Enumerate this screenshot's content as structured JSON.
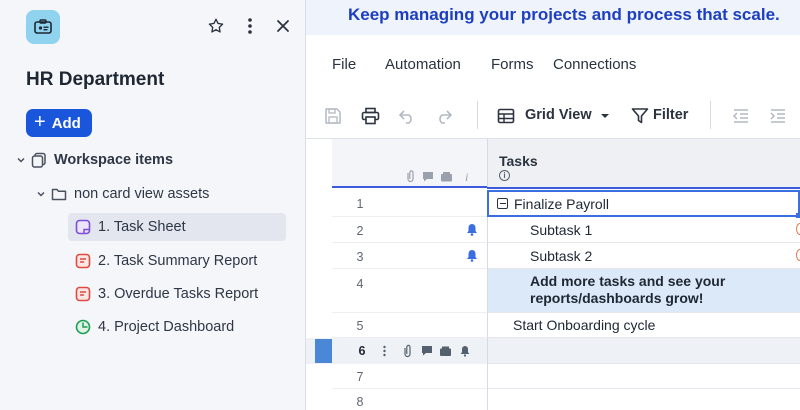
{
  "banner": {
    "text": "Keep managing your projects and process that scale."
  },
  "panel": {
    "title": "HR Department",
    "add_label": "Add",
    "tree": [
      {
        "label": "Workspace items",
        "level": 0,
        "icon": "workspace-icon",
        "bold": true
      },
      {
        "label": "non card view assets",
        "level": 1,
        "icon": "folder-icon",
        "bold": false
      },
      {
        "label": "1. Task Sheet",
        "level": 2,
        "icon": "sheet-icon",
        "color": "#7b4fd6",
        "selected": true
      },
      {
        "label": "2. Task Summary Report",
        "level": 2,
        "icon": "report-icon",
        "color": "#e04a3f"
      },
      {
        "label": "3. Overdue Tasks Report",
        "level": 2,
        "icon": "report-icon",
        "color": "#e04a3f"
      },
      {
        "label": "4. Project Dashboard",
        "level": 2,
        "icon": "dashboard-icon",
        "color": "#1f9d55"
      }
    ]
  },
  "menu": {
    "items": [
      "File",
      "Automation",
      "Forms",
      "Connections"
    ]
  },
  "toolbar": {
    "view_label": "Grid View",
    "filter_label": "Filter"
  },
  "grid": {
    "column_header": "Tasks",
    "rows": [
      {
        "num": "1",
        "text": "Finalize Payroll",
        "type": "parent"
      },
      {
        "num": "2",
        "text": "Subtask 1",
        "type": "child",
        "bell": true
      },
      {
        "num": "3",
        "text": "Subtask 2",
        "type": "child",
        "bell": true
      },
      {
        "num": "4",
        "text": "Add more tasks and see your reports/dashboards grow!",
        "type": "note"
      },
      {
        "num": "5",
        "text": "Start Onboarding cycle",
        "type": "plain"
      },
      {
        "num": "6",
        "text": "",
        "type": "active"
      },
      {
        "num": "7",
        "text": "",
        "type": "empty"
      },
      {
        "num": "8",
        "text": "",
        "type": "empty"
      }
    ]
  },
  "colors": {
    "accent": "#1a56db",
    "banner_text": "#1d3fbf",
    "selection": "#dce9f8"
  }
}
